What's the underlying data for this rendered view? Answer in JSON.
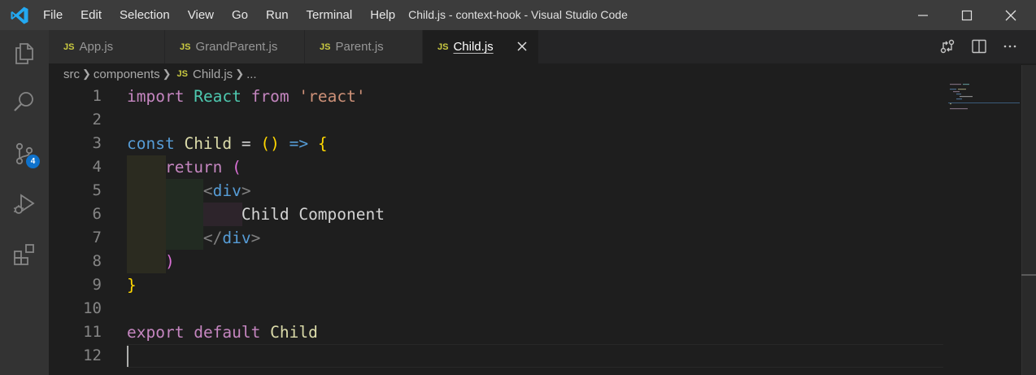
{
  "titlebar": {
    "menu": [
      "File",
      "Edit",
      "Selection",
      "View",
      "Go",
      "Run",
      "Terminal",
      "Help"
    ],
    "title": "Child.js - context-hook - Visual Studio Code",
    "controls": [
      "minimize-icon",
      "maximize-icon",
      "close-icon"
    ]
  },
  "activitybar": {
    "items": [
      "explorer-icon",
      "search-icon",
      "source-control-icon",
      "run-debug-icon",
      "extensions-icon"
    ],
    "source_control_badge": "4"
  },
  "tabs": [
    {
      "label": "App.js",
      "file_badge": "JS",
      "active": false
    },
    {
      "label": "GrandParent.js",
      "file_badge": "JS",
      "active": false
    },
    {
      "label": "Parent.js",
      "file_badge": "JS",
      "active": false
    },
    {
      "label": "Child.js",
      "file_badge": "JS",
      "active": true
    }
  ],
  "editor_actions": [
    "open-changes-icon",
    "split-editor-icon",
    "more-actions-icon"
  ],
  "breadcrumb": {
    "parts": [
      "src",
      "components",
      "Child.js",
      "..."
    ],
    "file_badge": "JS"
  },
  "editor": {
    "line_numbers": [
      "1",
      "2",
      "3",
      "4",
      "5",
      "6",
      "7",
      "8",
      "9",
      "10",
      "11",
      "12"
    ],
    "lines": [
      [
        {
          "t": "import",
          "c": "kw"
        },
        {
          "t": " ",
          "c": "plain"
        },
        {
          "t": "React",
          "c": "cls"
        },
        {
          "t": " ",
          "c": "plain"
        },
        {
          "t": "from",
          "c": "kw"
        },
        {
          "t": " ",
          "c": "plain"
        },
        {
          "t": "'react'",
          "c": "str"
        }
      ],
      [],
      [
        {
          "t": "const",
          "c": "kwb"
        },
        {
          "t": " ",
          "c": "plain"
        },
        {
          "t": "Child",
          "c": "var"
        },
        {
          "t": " = ",
          "c": "plain"
        },
        {
          "t": "()",
          "c": "brace"
        },
        {
          "t": " ",
          "c": "plain"
        },
        {
          "t": "=>",
          "c": "kwb"
        },
        {
          "t": " ",
          "c": "plain"
        },
        {
          "t": "{",
          "c": "brace"
        }
      ],
      [
        {
          "t": "    ",
          "c": "plain"
        },
        {
          "t": "return",
          "c": "kw"
        },
        {
          "t": " ",
          "c": "plain"
        },
        {
          "t": "(",
          "c": "paren"
        }
      ],
      [
        {
          "t": "        ",
          "c": "plain"
        },
        {
          "t": "<",
          "c": "punct"
        },
        {
          "t": "div",
          "c": "tag"
        },
        {
          "t": ">",
          "c": "punct"
        }
      ],
      [
        {
          "t": "            ",
          "c": "plain"
        },
        {
          "t": "Child Component",
          "c": "plain"
        }
      ],
      [
        {
          "t": "        ",
          "c": "plain"
        },
        {
          "t": "</",
          "c": "punct"
        },
        {
          "t": "div",
          "c": "tag"
        },
        {
          "t": ">",
          "c": "punct"
        }
      ],
      [
        {
          "t": "    ",
          "c": "plain"
        },
        {
          "t": ")",
          "c": "paren"
        }
      ],
      [
        {
          "t": "}",
          "c": "brace"
        }
      ],
      [],
      [
        {
          "t": "export",
          "c": "kw"
        },
        {
          "t": " ",
          "c": "plain"
        },
        {
          "t": "default",
          "c": "kw"
        },
        {
          "t": " ",
          "c": "plain"
        },
        {
          "t": "Child",
          "c": "var"
        }
      ],
      []
    ]
  },
  "colors": {
    "titlebar": "#3c3c3c",
    "activitybar": "#333333",
    "editor_bg": "#1e1e1e",
    "badge": "#0e72cc",
    "js_badge": "#cbcb41"
  }
}
